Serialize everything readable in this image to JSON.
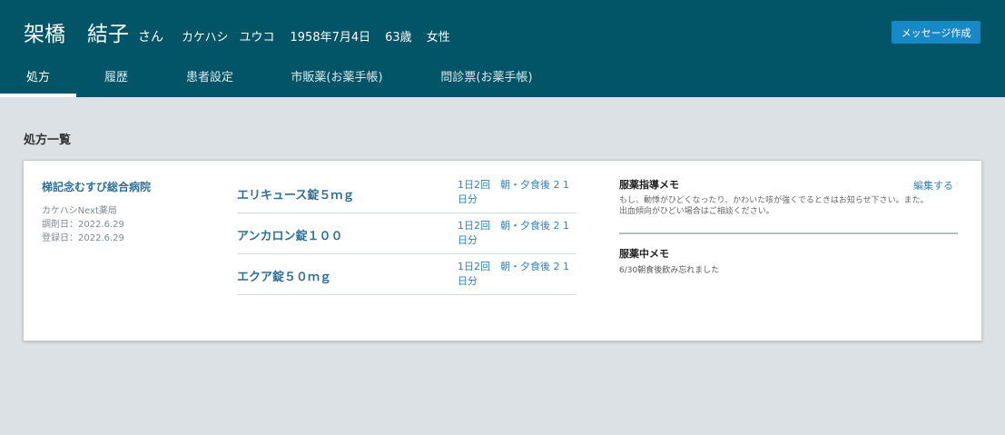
{
  "patient": {
    "family_name": "架橋",
    "given_name": "結子",
    "honorific": "さん",
    "kana_family": "カケハシ",
    "kana_given": "ユウコ",
    "birthdate": "1958年7月4日",
    "age": "63歳",
    "sex": "女性"
  },
  "header": {
    "message_button": "メッセージ作成"
  },
  "tabs": [
    {
      "label": "処方",
      "active": true
    },
    {
      "label": "履歴",
      "active": false
    },
    {
      "label": "患者設定",
      "active": false
    },
    {
      "label": "市販薬(お薬手帳)",
      "active": false
    },
    {
      "label": "問診票(お薬手帳)",
      "active": false
    }
  ],
  "main": {
    "section_title": "処方一覧"
  },
  "prescription": {
    "hospital": "梯記念むすび総合病院",
    "pharmacy": "カケハシNext薬局",
    "dispensed": "調剤日：2022.6.29",
    "registered": "登録日：2022.6.29",
    "drugs": [
      {
        "name": "エリキュース錠５ｍｇ",
        "dosage": "1日2回　朝・夕食後 2 1日分"
      },
      {
        "name": "アンカロン錠１００",
        "dosage": "1日2回　朝・夕食後 2 1日分"
      },
      {
        "name": "エクア錠５０ｍｇ",
        "dosage": "1日2回　朝・夕食後 2 1日分"
      }
    ]
  },
  "memo": {
    "guidance_title": "服薬指導メモ",
    "edit_label": "編集する",
    "guidance_line1": "もし、動悸がひどくなったり、かわいた咳が強くでるときはお知らせ下さい。また。",
    "guidance_line2": "出血傾向がひどい場合はご相談ください。",
    "current_title": "服薬中メモ",
    "current_text": "6/30朝食後飲み忘れました"
  },
  "colors": {
    "header_bg": "#025567",
    "accent_button": "#1789c7",
    "link": "#2d6f98",
    "page_bg": "#dbe1e4"
  }
}
